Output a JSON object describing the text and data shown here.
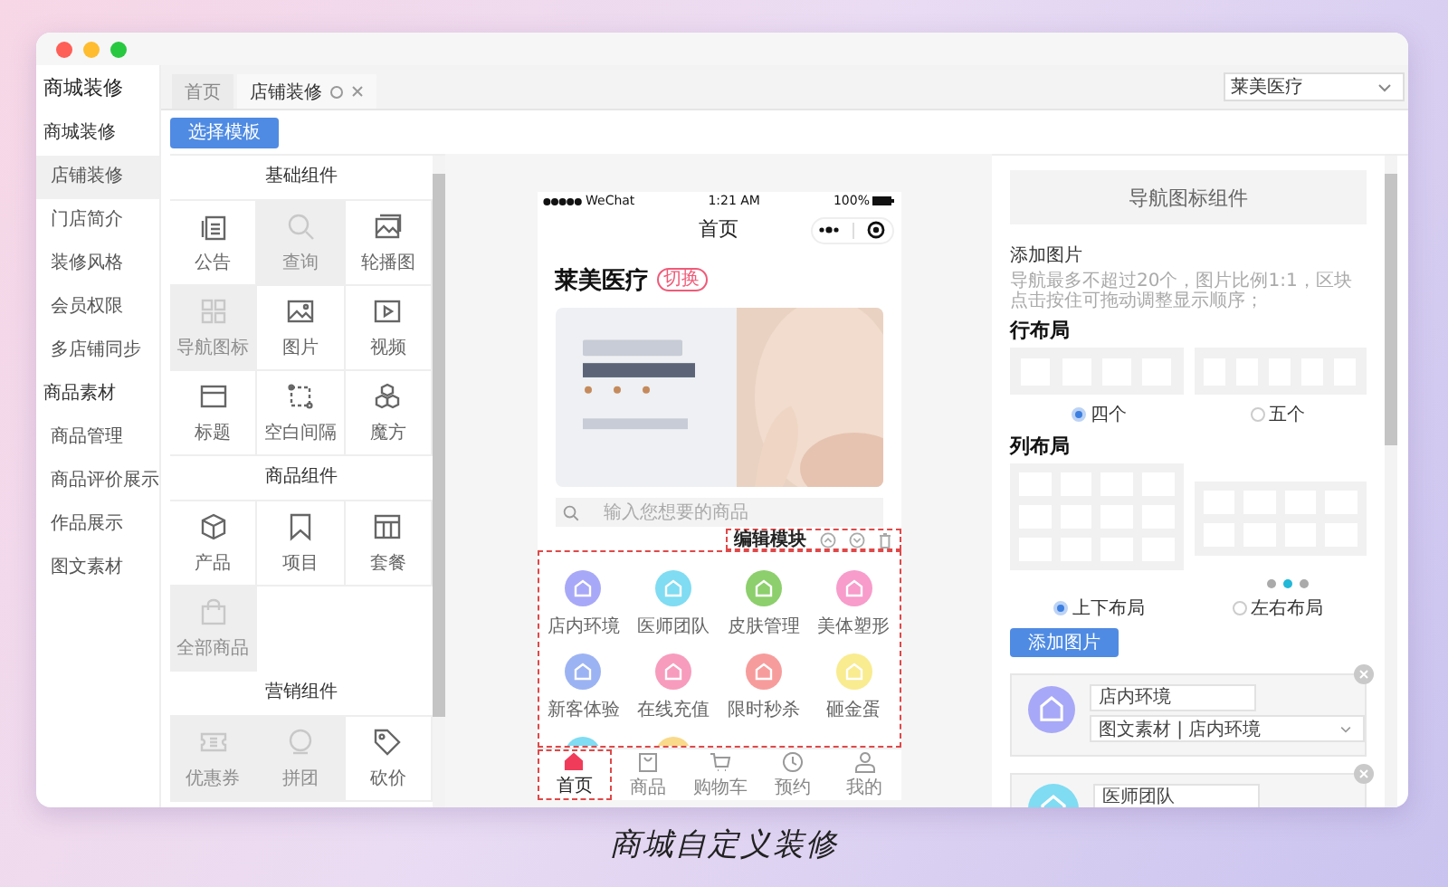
{
  "sidebar": {
    "title": "商城装修",
    "groups": [
      {
        "label": "商城装修",
        "items": [
          {
            "label": "店铺装修",
            "selected": true
          },
          {
            "label": "门店简介",
            "selected": false
          },
          {
            "label": "装修风格",
            "selected": false
          },
          {
            "label": "会员权限",
            "selected": false
          },
          {
            "label": "多店铺同步",
            "selected": false
          }
        ]
      },
      {
        "label": "商品素材",
        "items": [
          {
            "label": "商品管理",
            "selected": false
          },
          {
            "label": "商品评价展示",
            "selected": false
          },
          {
            "label": "作品展示",
            "selected": false
          },
          {
            "label": "图文素材",
            "selected": false
          }
        ]
      }
    ]
  },
  "tabs": [
    {
      "label": "首页",
      "selected": false,
      "closable": false
    },
    {
      "label": "店铺装修",
      "selected": true,
      "closable": true
    }
  ],
  "store_select": {
    "value": "莱美医疗"
  },
  "template_button": "选择模板",
  "components": [
    {
      "title": "基础组件",
      "items": [
        {
          "label": "公告",
          "disabled": false
        },
        {
          "label": "查询",
          "disabled": true
        },
        {
          "label": "轮播图",
          "disabled": false
        },
        {
          "label": "导航图标",
          "disabled": true
        },
        {
          "label": "图片",
          "disabled": false
        },
        {
          "label": "视频",
          "disabled": false
        },
        {
          "label": "标题",
          "disabled": false
        },
        {
          "label": "空白间隔",
          "disabled": false
        },
        {
          "label": "魔方",
          "disabled": false
        }
      ]
    },
    {
      "title": "商品组件",
      "items": [
        {
          "label": "产品",
          "disabled": false
        },
        {
          "label": "项目",
          "disabled": false
        },
        {
          "label": "套餐",
          "disabled": false
        },
        {
          "label": "全部商品",
          "disabled": true
        }
      ]
    },
    {
      "title": "营销组件",
      "items": [
        {
          "label": "优惠券",
          "disabled": true
        },
        {
          "label": "拼团",
          "disabled": true
        },
        {
          "label": "砍价",
          "disabled": false
        }
      ]
    }
  ],
  "phone": {
    "status": {
      "carrier": "WeChat",
      "time": "1:21 AM",
      "battery": "100%"
    },
    "title": "首页",
    "store_name": "莱美医疗",
    "switch_badge": "切换",
    "search_placeholder": "输入您想要的商品",
    "edit_bar": "编辑模块",
    "nav_icons": [
      {
        "label": "店内环境",
        "color": "#a8a8f8"
      },
      {
        "label": "医师团队",
        "color": "#7fdcf2"
      },
      {
        "label": "皮肤管理",
        "color": "#8ccf6c"
      },
      {
        "label": "美体塑形",
        "color": "#f79ccb"
      },
      {
        "label": "新客体验",
        "color": "#9cb3f3"
      },
      {
        "label": "在线充值",
        "color": "#f79cbc"
      },
      {
        "label": "限时秒杀",
        "color": "#f79c9c"
      },
      {
        "label": "砸金蛋",
        "color": "#f9eb90"
      },
      {
        "color": "#7fdcf2"
      },
      {
        "color": "#f9d98a"
      }
    ],
    "tab_bar": [
      {
        "label": "首页",
        "selected": true
      },
      {
        "label": "商品",
        "selected": false
      },
      {
        "label": "购物车",
        "selected": false
      },
      {
        "label": "预约",
        "selected": false
      },
      {
        "label": "我的",
        "selected": false
      }
    ]
  },
  "settings": {
    "title": "导航图标组件",
    "add_title": "添加图片",
    "hint": "导航最多不超过20个，图片比例1:1，区块点击按住可拖动调整显示顺序；",
    "row_layout": {
      "title": "行布局",
      "options": [
        {
          "label": "四个",
          "selected": true
        },
        {
          "label": "五个",
          "selected": false
        }
      ]
    },
    "column_layout": {
      "title": "列布局",
      "dots": [
        {
          "selected": false
        },
        {
          "selected": true
        },
        {
          "selected": false
        }
      ],
      "options": [
        {
          "label": "上下布局",
          "selected": true
        },
        {
          "label": "左右布局",
          "selected": false
        }
      ]
    },
    "add_button": "添加图片",
    "entries": [
      {
        "name": "店内环境",
        "link": "图文素材 | 店内环境",
        "color": "#a8a8f8"
      },
      {
        "name": "医师团队",
        "color": "#7fdcf2"
      }
    ]
  },
  "caption": "商城自定义装修"
}
